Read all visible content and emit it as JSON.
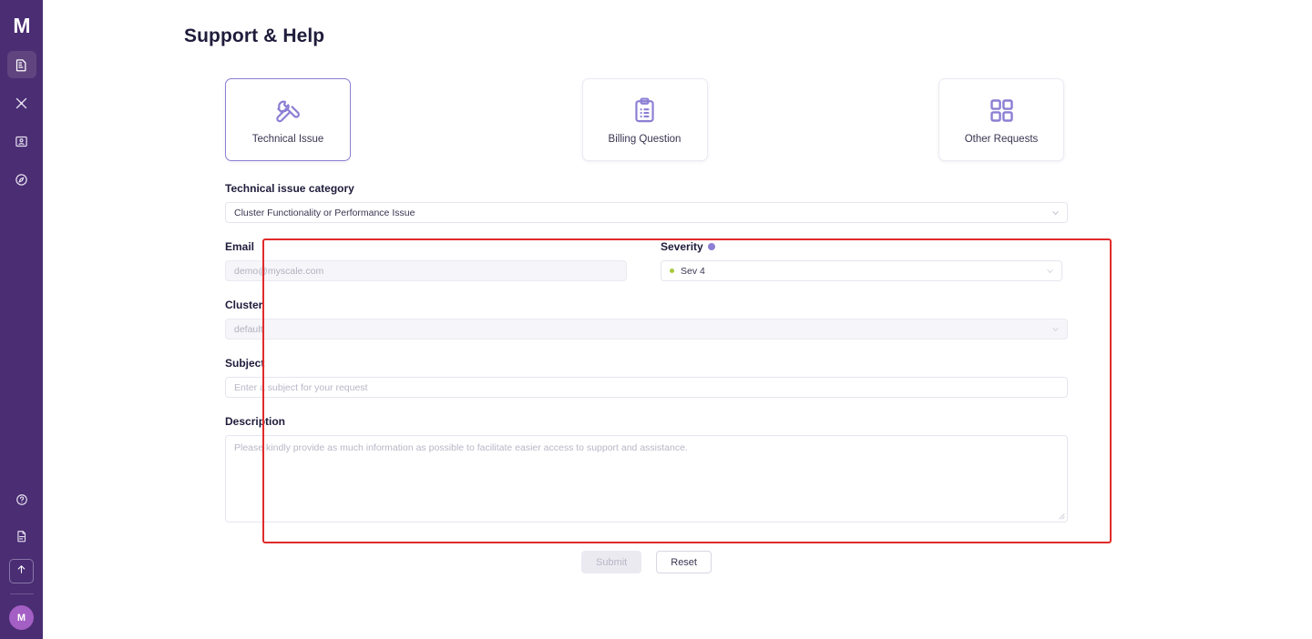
{
  "sidebar": {
    "logo": "M",
    "nav_top": [
      {
        "name": "clusters",
        "icon": "database-icon",
        "active": true
      },
      {
        "name": "tools",
        "icon": "wrench-icon",
        "active": false
      },
      {
        "name": "account",
        "icon": "id-card-icon",
        "active": false
      },
      {
        "name": "explore",
        "icon": "compass-icon",
        "active": false
      }
    ],
    "nav_bottom": [
      {
        "name": "help",
        "icon": "help-circle-icon"
      },
      {
        "name": "docs",
        "icon": "document-icon"
      }
    ],
    "upgrade": {
      "icon": "arrow-up-icon"
    },
    "avatar_initial": "M"
  },
  "header": {
    "title": "Support & Help"
  },
  "cards": [
    {
      "label": "Technical Issue",
      "icon": "tools-icon",
      "selected": true
    },
    {
      "label": "Billing Question",
      "icon": "clipboard-list-icon",
      "selected": false
    },
    {
      "label": "Other Requests",
      "icon": "grid-icon",
      "selected": false
    }
  ],
  "form": {
    "category": {
      "label": "Technical issue category",
      "value": "Cluster Functionality or Performance Issue"
    },
    "email": {
      "label": "Email",
      "value": "demo@myscale.com",
      "disabled": true
    },
    "severity": {
      "label": "Severity",
      "value": "Sev 4",
      "dot_color": "#a9c93a",
      "info_color": "#8b7fd4"
    },
    "cluster": {
      "label": "Cluster",
      "value": "default",
      "disabled": true
    },
    "subject": {
      "label": "Subject",
      "placeholder": "Enter a subject for your request",
      "value": ""
    },
    "description": {
      "label": "Description",
      "placeholder": "Please kindly provide as much information as possible to facilitate easier access to support and assistance.",
      "value": ""
    }
  },
  "actions": {
    "submit_label": "Submit",
    "submit_disabled": true,
    "reset_label": "Reset"
  },
  "annotation": {
    "color": "#e02b2b"
  }
}
